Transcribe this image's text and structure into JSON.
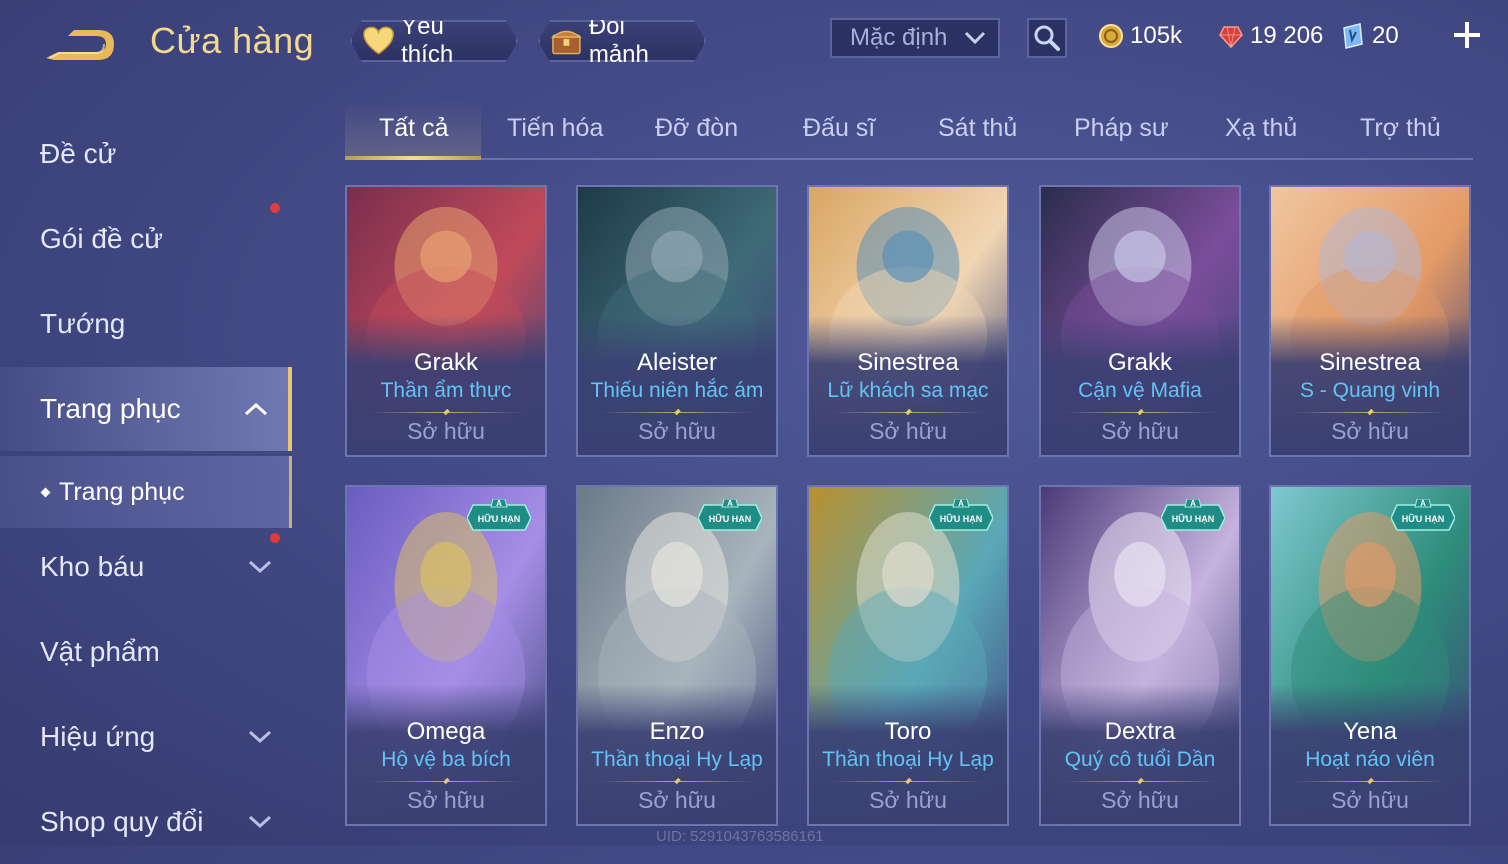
{
  "header": {
    "title": "Cửa hàng",
    "favorites_label": "Yêu thích",
    "fragments_label": "Đổi mảnh",
    "sort_value": "Mặc định",
    "currencies": [
      {
        "name": "gold",
        "value": "105k"
      },
      {
        "name": "ruby",
        "value": "19 206"
      },
      {
        "name": "voucher",
        "value": "20"
      }
    ]
  },
  "sidebar": {
    "items": [
      {
        "label": "Đề cử"
      },
      {
        "label": "Gói đề cử"
      },
      {
        "label": "Tướng"
      },
      {
        "label": "Trang phục"
      },
      {
        "label": "Kho báu"
      },
      {
        "label": "Vật phẩm"
      },
      {
        "label": "Hiệu ứng"
      },
      {
        "label": "Shop quy đổi"
      }
    ],
    "sub_item": "Trang phục"
  },
  "tabs": [
    "Tất cả",
    "Tiến hóa",
    "Đỡ đòn",
    "Đấu sĩ",
    "Sát thủ",
    "Pháp sư",
    "Xạ thủ",
    "Trợ thủ"
  ],
  "cards": [
    {
      "hero": "Grakk",
      "skin": "Thần ẩm thực",
      "status": "Sở hữu",
      "palette": [
        "#7a2e4e",
        "#c04a5a",
        "#e8a070"
      ]
    },
    {
      "hero": "Aleister",
      "skin": "Thiếu niên hắc ám",
      "status": "Sở hữu",
      "palette": [
        "#1e3a48",
        "#3f6a78",
        "#8fa6b0"
      ]
    },
    {
      "hero": "Sinestrea",
      "skin": "Lữ khách sa mạc",
      "status": "Sở hữu",
      "palette": [
        "#d9a662",
        "#f1d6b4",
        "#5a90b8"
      ]
    },
    {
      "hero": "Grakk",
      "skin": "Cận vệ Mafia",
      "status": "Sở hữu",
      "palette": [
        "#2a2d4c",
        "#7b4d9a",
        "#c8c4e6"
      ]
    },
    {
      "hero": "Sinestrea",
      "skin": "S - Quang vinh",
      "status": "Sở hữu",
      "palette": [
        "#f0c6a0",
        "#e39a66",
        "#b6b6d0"
      ]
    },
    {
      "hero": "Omega",
      "skin": "Hộ vệ ba bích",
      "status": "Sở hữu",
      "badge": "HỮU HẠN",
      "badge_rank": "A",
      "palette": [
        "#6a5cc0",
        "#a68ee6",
        "#d8c064"
      ]
    },
    {
      "hero": "Enzo",
      "skin": "Thần thoại Hy Lạp",
      "status": "Sở hữu",
      "badge": "HỮU HẠN",
      "badge_rank": "A",
      "palette": [
        "#6c7a88",
        "#a8b4bc",
        "#e6e4de"
      ]
    },
    {
      "hero": "Toro",
      "skin": "Thần thoại Hy Lạp",
      "status": "Sở hữu",
      "badge": "HỮU HẠN",
      "badge_rank": "A",
      "palette": [
        "#b89030",
        "#5aa8b8",
        "#e0dccc"
      ]
    },
    {
      "hero": "Dextra",
      "skin": "Quý cô tuổi Dần",
      "status": "Sở hữu",
      "badge": "HỮU HẠN",
      "badge_rank": "A",
      "palette": [
        "#4a3a78",
        "#c6b2de",
        "#e8e2f2"
      ]
    },
    {
      "hero": "Yena",
      "skin": "Hoạt náo viên",
      "status": "Sở hữu",
      "badge": "HỮU HẠN",
      "badge_rank": "A",
      "palette": [
        "#7ec8d0",
        "#2e8c7a",
        "#e09a6a"
      ]
    }
  ],
  "footer_uid": "UID: 5291043763586161"
}
